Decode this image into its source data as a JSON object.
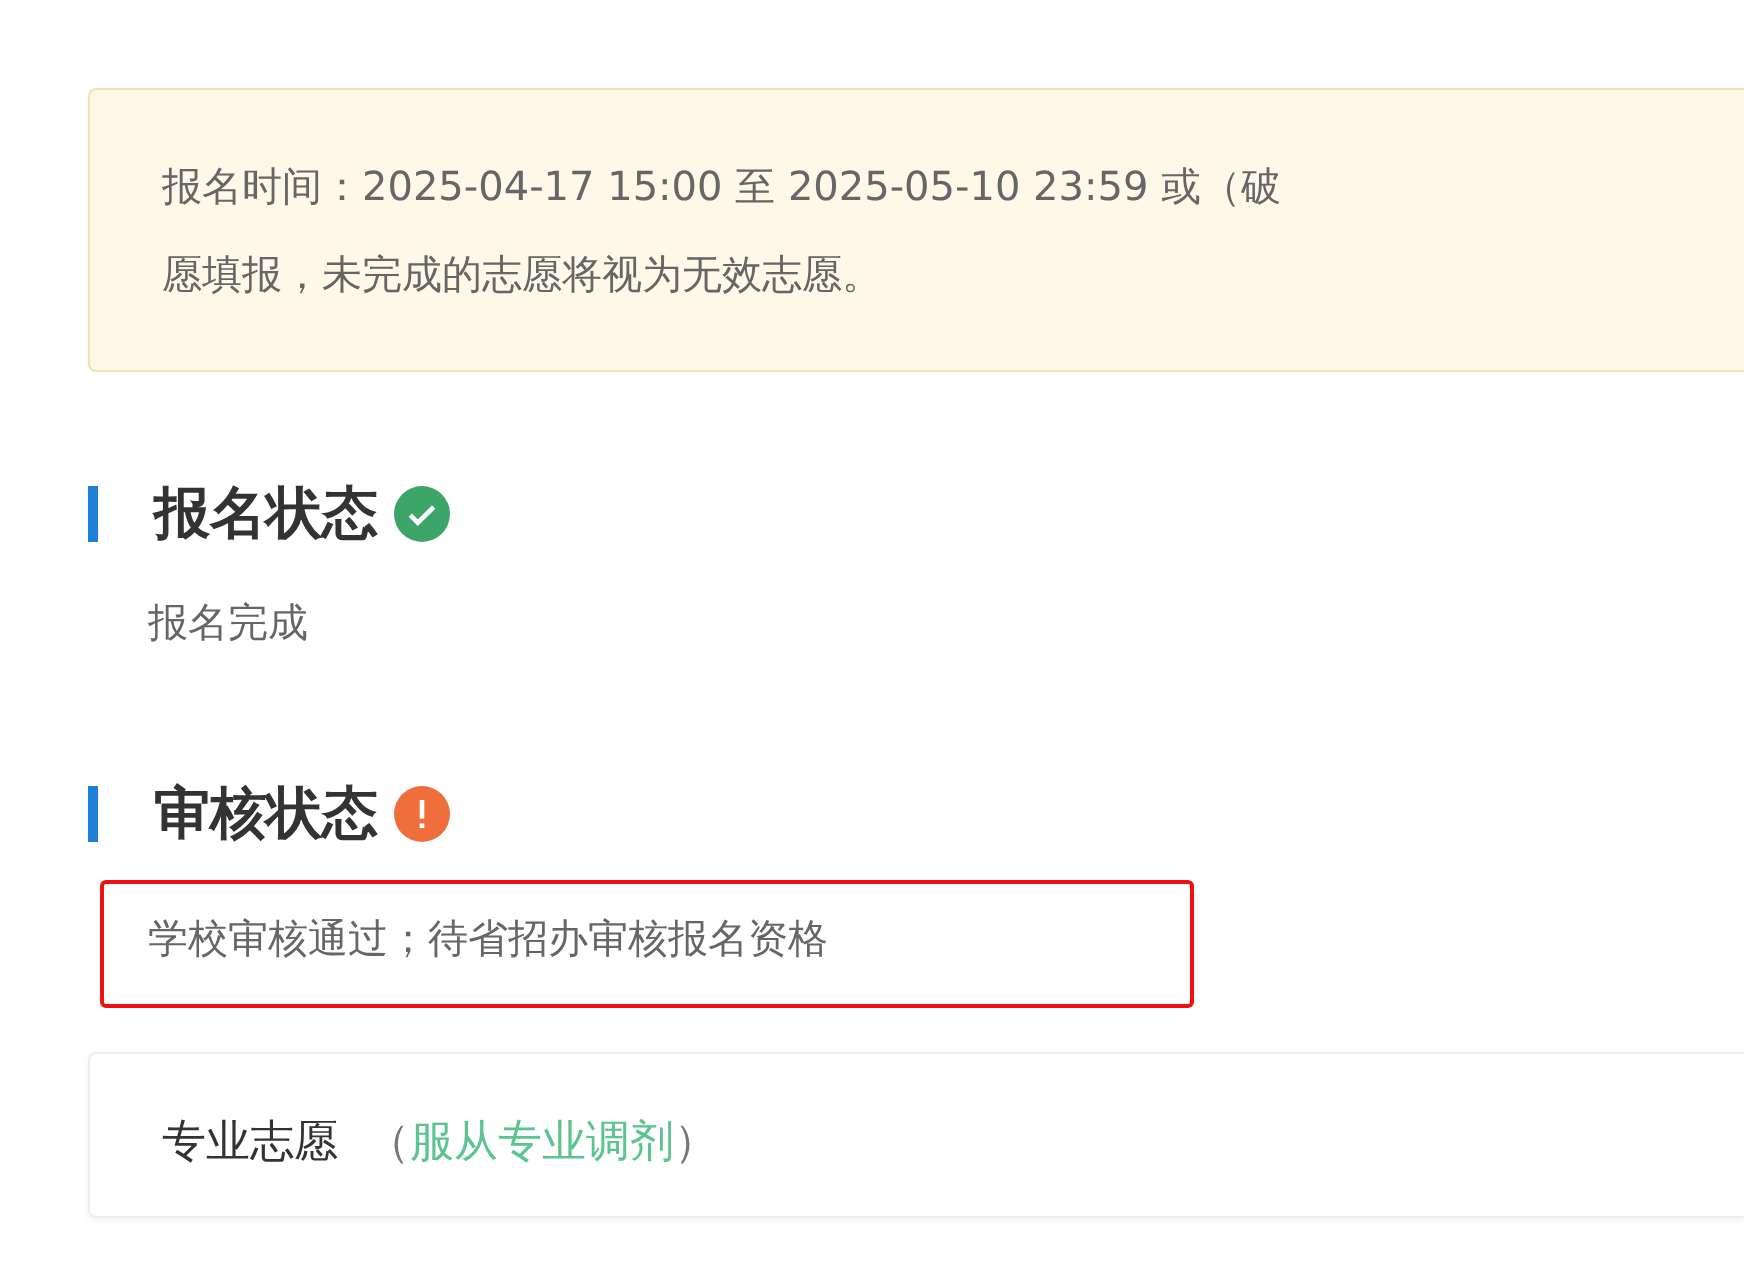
{
  "notice": {
    "lines": [
      "报名时间：2025-04-17 15:00 至 2025-05-10 23:59 或（破",
      "愿填报，未完成的志愿将视为无效志愿。"
    ]
  },
  "statuses": [
    {
      "title": "报名状态",
      "kind": "success",
      "text": "报名完成",
      "highlighted": false
    },
    {
      "title": "审核状态",
      "kind": "warning",
      "text": "学校审核通过；待省招办审核报名资格",
      "highlighted": true
    }
  ],
  "preference_card": {
    "title": "专业志愿",
    "note_open": "（",
    "note": "服从专业调剂",
    "note_close": "）"
  }
}
